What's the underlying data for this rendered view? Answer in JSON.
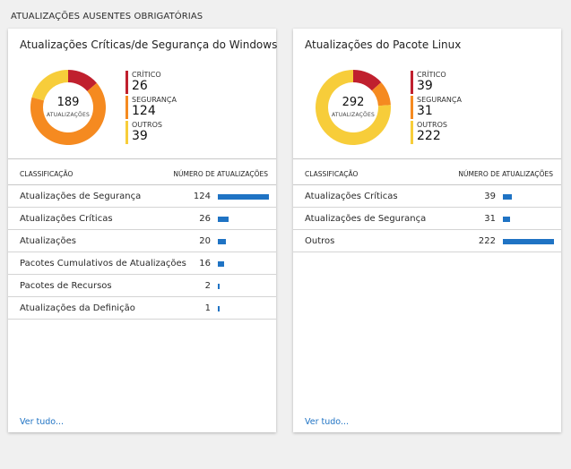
{
  "page": {
    "section_title": "ATUALIZAÇÕES AUSENTES OBRIGATÓRIAS"
  },
  "colors": {
    "critical": "#c0202e",
    "security": "#f58a20",
    "others": "#f7cd3a",
    "bar": "#1f73c4"
  },
  "panels": [
    {
      "title": "Atualizações Críticas/de Segurança do Windows",
      "donut": {
        "total": "189",
        "caption": "ATUALIZAÇÕES",
        "fractions": [
          26,
          124,
          39
        ]
      },
      "legend": [
        {
          "label": "CRÍTICO",
          "value": "26",
          "color": "#c0202e"
        },
        {
          "label": "SEGURANÇA",
          "value": "124",
          "color": "#f58a20"
        },
        {
          "label": "OUTROS",
          "value": "39",
          "color": "#f7cd3a"
        }
      ],
      "table": {
        "col_class": "CLASSIFICAÇÃO",
        "col_count": "NÚMERO DE ATUALIZAÇÕES",
        "rows": [
          {
            "name": "Atualizações de Segurança",
            "count": "124",
            "value": 124
          },
          {
            "name": "Atualizações Críticas",
            "count": "26",
            "value": 26
          },
          {
            "name": "Atualizações",
            "count": "20",
            "value": 20
          },
          {
            "name": "Pacotes Cumulativos de Atualizações",
            "count": "16",
            "value": 16
          },
          {
            "name": "Pacotes de Recursos",
            "count": "2",
            "value": 2
          },
          {
            "name": "Atualizações da Definição",
            "count": "1",
            "value": 1
          }
        ],
        "max": 124
      },
      "see_all": "Ver tudo..."
    },
    {
      "title": "Atualizações do Pacote Linux",
      "donut": {
        "total": "292",
        "caption": "ATUALIZAÇÕES",
        "fractions": [
          39,
          31,
          222
        ]
      },
      "legend": [
        {
          "label": "CRÍTICO",
          "value": "39",
          "color": "#c0202e"
        },
        {
          "label": "SEGURANÇA",
          "value": "31",
          "color": "#f58a20"
        },
        {
          "label": "OUTROS",
          "value": "222",
          "color": "#f7cd3a"
        }
      ],
      "table": {
        "col_class": "CLASSIFICAÇÃO",
        "col_count": "NÚMERO DE ATUALIZAÇÕES",
        "rows": [
          {
            "name": "Atualizações Críticas",
            "count": "39",
            "value": 39
          },
          {
            "name": "Atualizações de Segurança",
            "count": "31",
            "value": 31
          },
          {
            "name": "Outros",
            "count": "222",
            "value": 222
          }
        ],
        "max": 222
      },
      "see_all": "Ver tudo..."
    }
  ]
}
